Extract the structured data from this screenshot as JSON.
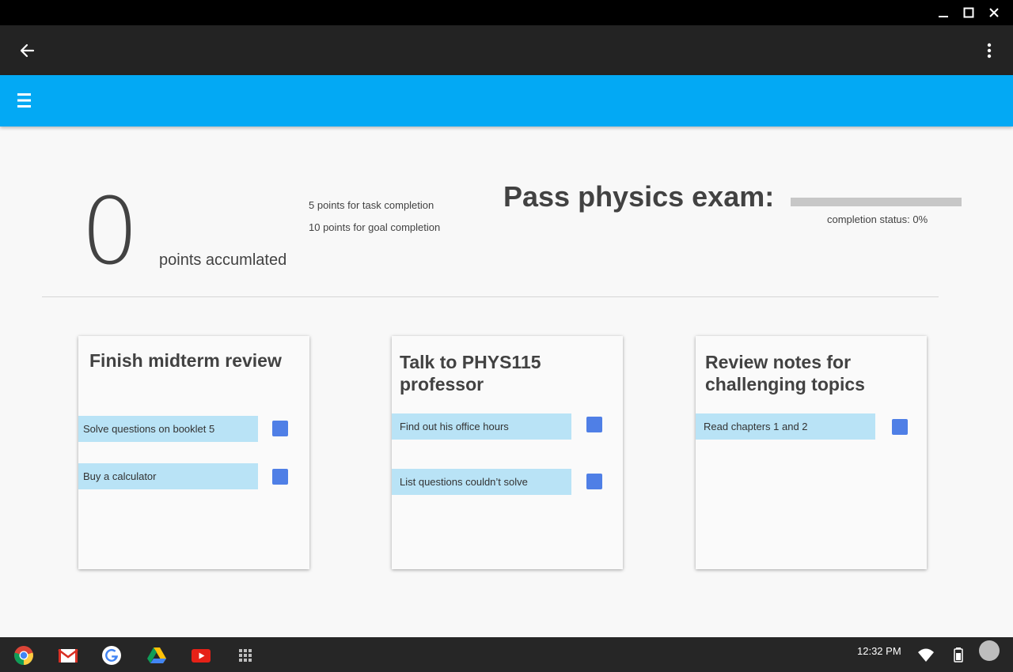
{
  "window": {
    "minimize_icon": "minimize-icon",
    "maximize_icon": "maximize-icon",
    "close_icon": "close-icon"
  },
  "appbar": {
    "back_icon": "arrow-back-icon",
    "overflow_icon": "more-vert-icon"
  },
  "toolbar": {
    "menu_icon": "hamburger-menu-icon",
    "color": "#03a9f4"
  },
  "score": {
    "points": "0",
    "label": "points accumlated",
    "rule_task": "5 points for task completion",
    "rule_goal": "10 points for goal completion"
  },
  "goal": {
    "title": "Pass physics exam:",
    "progress_fraction": 0,
    "status_text": "completion status: 0%"
  },
  "cards": [
    {
      "title": "Finish midterm review",
      "tasks": [
        {
          "label": "Solve questions on booklet 5"
        },
        {
          "label": "Buy a calculator"
        }
      ]
    },
    {
      "title": "Talk to PHYS115 professor",
      "tasks": [
        {
          "label": "Find out his office hours"
        },
        {
          "label": "List questions couldn’t solve"
        }
      ]
    },
    {
      "title": "Review notes for challenging topics",
      "tasks": [
        {
          "label": "Read chapters 1 and 2"
        }
      ]
    }
  ],
  "shelf": {
    "apps": [
      "chrome-icon",
      "gmail-icon",
      "google-search-icon",
      "drive-icon",
      "youtube-icon",
      "app-launcher-icon"
    ],
    "time": "12:32 PM",
    "status_icons": [
      "wifi-icon",
      "battery-icon",
      "account-avatar"
    ]
  },
  "colors": {
    "accent": "#03a9f4",
    "task_bg": "#b9e3f6",
    "checkbox": "#4f7fe6",
    "text": "#424242"
  }
}
